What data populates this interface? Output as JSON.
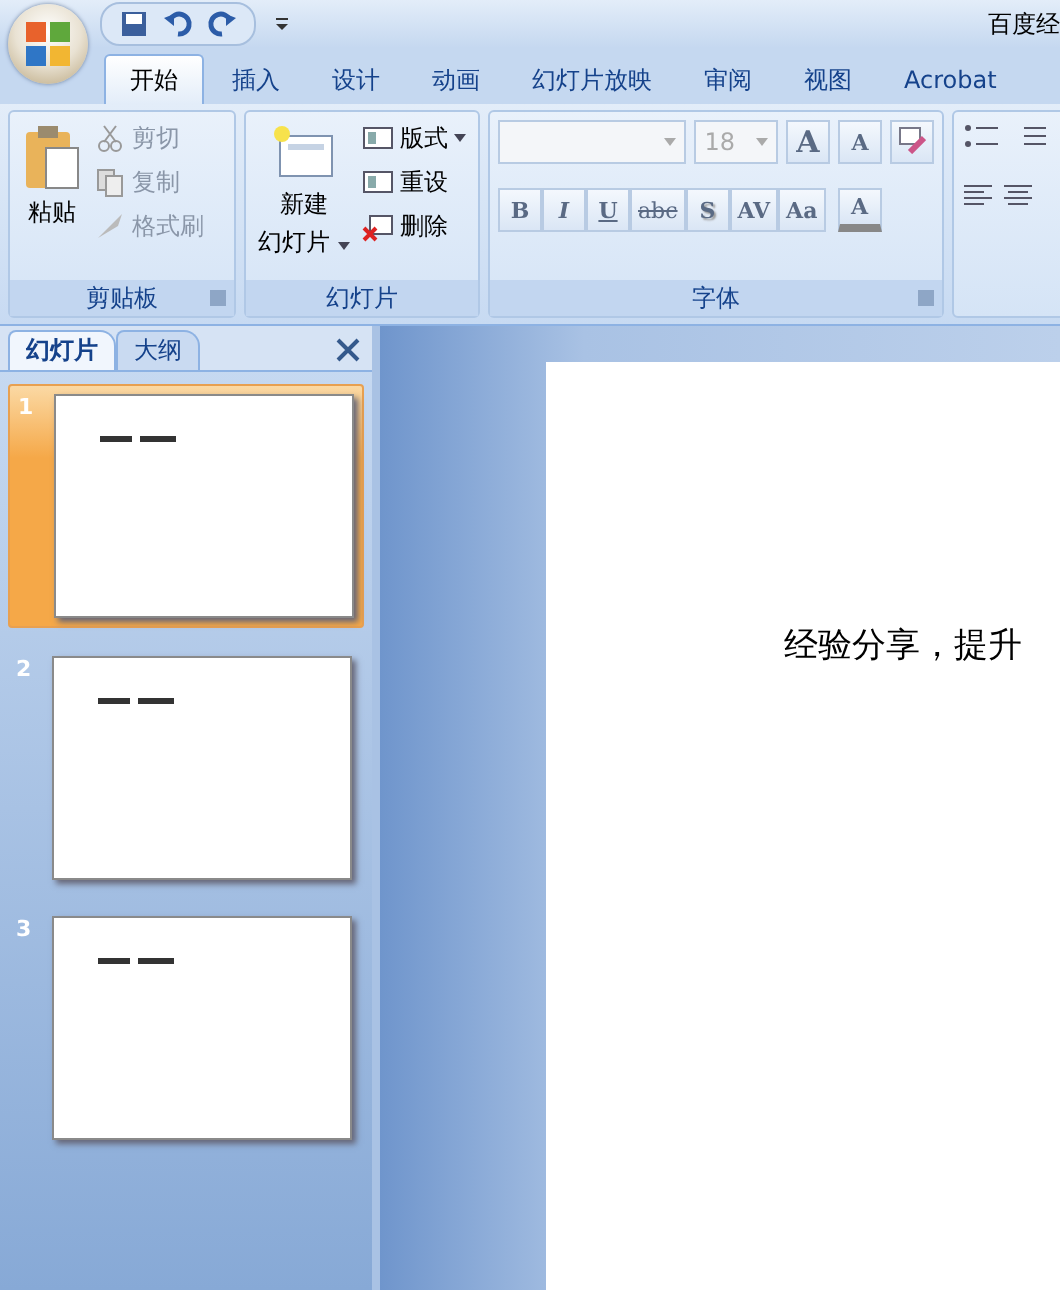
{
  "title": "百度经",
  "tabs": [
    {
      "label": "开始",
      "selected": true
    },
    {
      "label": "插入",
      "selected": false
    },
    {
      "label": "设计",
      "selected": false
    },
    {
      "label": "动画",
      "selected": false
    },
    {
      "label": "幻灯片放映",
      "selected": false
    },
    {
      "label": "审阅",
      "selected": false
    },
    {
      "label": "视图",
      "selected": false
    },
    {
      "label": "Acrobat",
      "selected": false
    }
  ],
  "clipboard": {
    "paste": "粘贴",
    "group": "剪贴板",
    "items": [
      {
        "label": "剪切",
        "disabled": true
      },
      {
        "label": "复制",
        "disabled": true
      },
      {
        "label": "格式刷",
        "disabled": true
      }
    ]
  },
  "slides_group": {
    "new_slide": "新建",
    "new_slide_2": "幻灯片",
    "group": "幻灯片",
    "items": [
      {
        "label": "版式",
        "dropdown": true
      },
      {
        "label": "重设",
        "dropdown": false
      },
      {
        "label": "删除",
        "dropdown": false
      }
    ]
  },
  "font": {
    "size": "18",
    "group": "字体",
    "grow": "A",
    "shrink": "A",
    "buttons": [
      {
        "label": "B",
        "kind": "bold"
      },
      {
        "label": "I",
        "kind": "italic"
      },
      {
        "label": "U",
        "kind": "underline"
      },
      {
        "label": "abc",
        "kind": "strike"
      },
      {
        "label": "S",
        "kind": "shadow"
      },
      {
        "label": "AV",
        "kind": "spacing"
      },
      {
        "label": "Aa",
        "kind": "case"
      }
    ],
    "color_label": "A"
  },
  "pane": {
    "tabs": [
      {
        "label": "幻灯片",
        "selected": true
      },
      {
        "label": "大纲",
        "selected": false
      }
    ]
  },
  "thumbnails": [
    {
      "number": "1",
      "selected": true
    },
    {
      "number": "2",
      "selected": false
    },
    {
      "number": "3",
      "selected": false
    }
  ],
  "slide": {
    "text": "经验分享，提升"
  }
}
